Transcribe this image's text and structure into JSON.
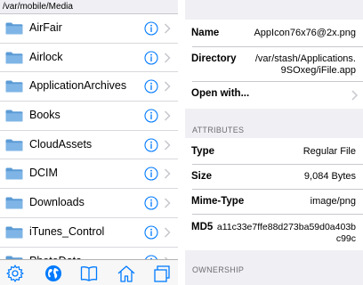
{
  "browser": {
    "path": "/var/mobile/Media",
    "folders": [
      {
        "name": "AirFair"
      },
      {
        "name": "Airlock"
      },
      {
        "name": "ApplicationArchives"
      },
      {
        "name": "Books"
      },
      {
        "name": "CloudAssets"
      },
      {
        "name": "DCIM"
      },
      {
        "name": "Downloads"
      },
      {
        "name": "iTunes_Control"
      },
      {
        "name": "PhotoData"
      }
    ],
    "tabs": [
      "gear-icon",
      "globe-icon",
      "book-icon",
      "home-icon",
      "windows-icon"
    ]
  },
  "details": {
    "name_label": "Name",
    "name_value": "AppIcon76x76@2x.png",
    "directory_label": "Directory",
    "directory_value_line1": "/var/stash/Applications.",
    "directory_value_line2": "9SOxeg/iFile.app",
    "open_with_label": "Open with...",
    "attributes_header": "ATTRIBUTES",
    "type_label": "Type",
    "type_value": "Regular File",
    "size_label": "Size",
    "size_value": "9,084 Bytes",
    "mime_label": "Mime-Type",
    "mime_value": "image/png",
    "md5_label": "MD5",
    "md5_value_line1": "a11c33e7ffe88d273ba59d0a403b",
    "md5_value_line2": "c99c",
    "ownership_header": "OWNERSHIP"
  },
  "colors": {
    "accent": "#007aff",
    "folder": "#5b9bd5",
    "group_bg": "#efeff4"
  }
}
